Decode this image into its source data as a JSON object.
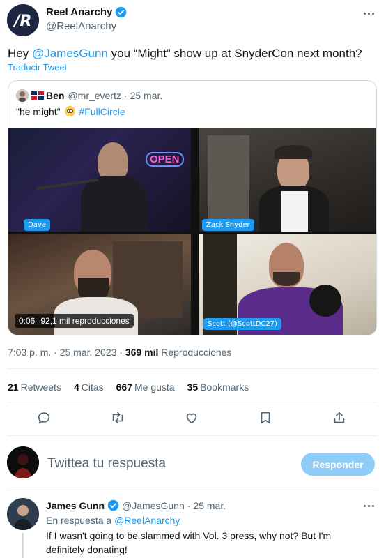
{
  "tweet": {
    "author_name": "Reel Anarchy",
    "author_handle": "@ReelAnarchy",
    "text_before": "Hey ",
    "text_mention": "@JamesGunn",
    "text_after": " you “Might” show up at SnyderCon next month?",
    "translate_label": "Traducir Tweet",
    "timestamp": "7:03 p. m. · 25 mar. 2023 · ",
    "views_count": "369 mil",
    "views_label": " Reproducciones"
  },
  "quote": {
    "name": "Ben",
    "handle": "@mr_evertz",
    "separator": "·",
    "date": "25 mar.",
    "text_before": "\"he might\" ",
    "hashtag": "#FullCircle",
    "video": {
      "time": "0:06",
      "views": "92,1 mil reproducciones",
      "sign": "OPEN",
      "participants": [
        "Dave",
        "Zack Snyder",
        "Scott (@ScottDC27)"
      ]
    }
  },
  "stats": {
    "retweets_count": "21",
    "retweets_label": "Retweets",
    "quotes_count": "4",
    "quotes_label": "Citas",
    "likes_count": "667",
    "likes_label": "Me gusta",
    "bookmarks_count": "35",
    "bookmarks_label": "Bookmarks"
  },
  "compose": {
    "placeholder": "Twittea tu respuesta",
    "button_label": "Responder"
  },
  "reply": {
    "name": "James Gunn",
    "handle": "@JamesGunn",
    "separator": "·",
    "date": "25 mar.",
    "replying_to_prefix": "En respuesta a ",
    "replying_to_handle": "@ReelAnarchy",
    "text": "If I wasn't going to be slammed with Vol. 3 press, why not? But I'm definitely donating!"
  },
  "colors": {
    "accent": "#1d9bf0",
    "reply_button": "#8ecdf8",
    "muted": "#536471"
  },
  "icons": [
    "verified-badge-icon",
    "more-icon",
    "reply-icon",
    "retweet-icon",
    "like-icon",
    "bookmark-icon",
    "share-icon"
  ]
}
